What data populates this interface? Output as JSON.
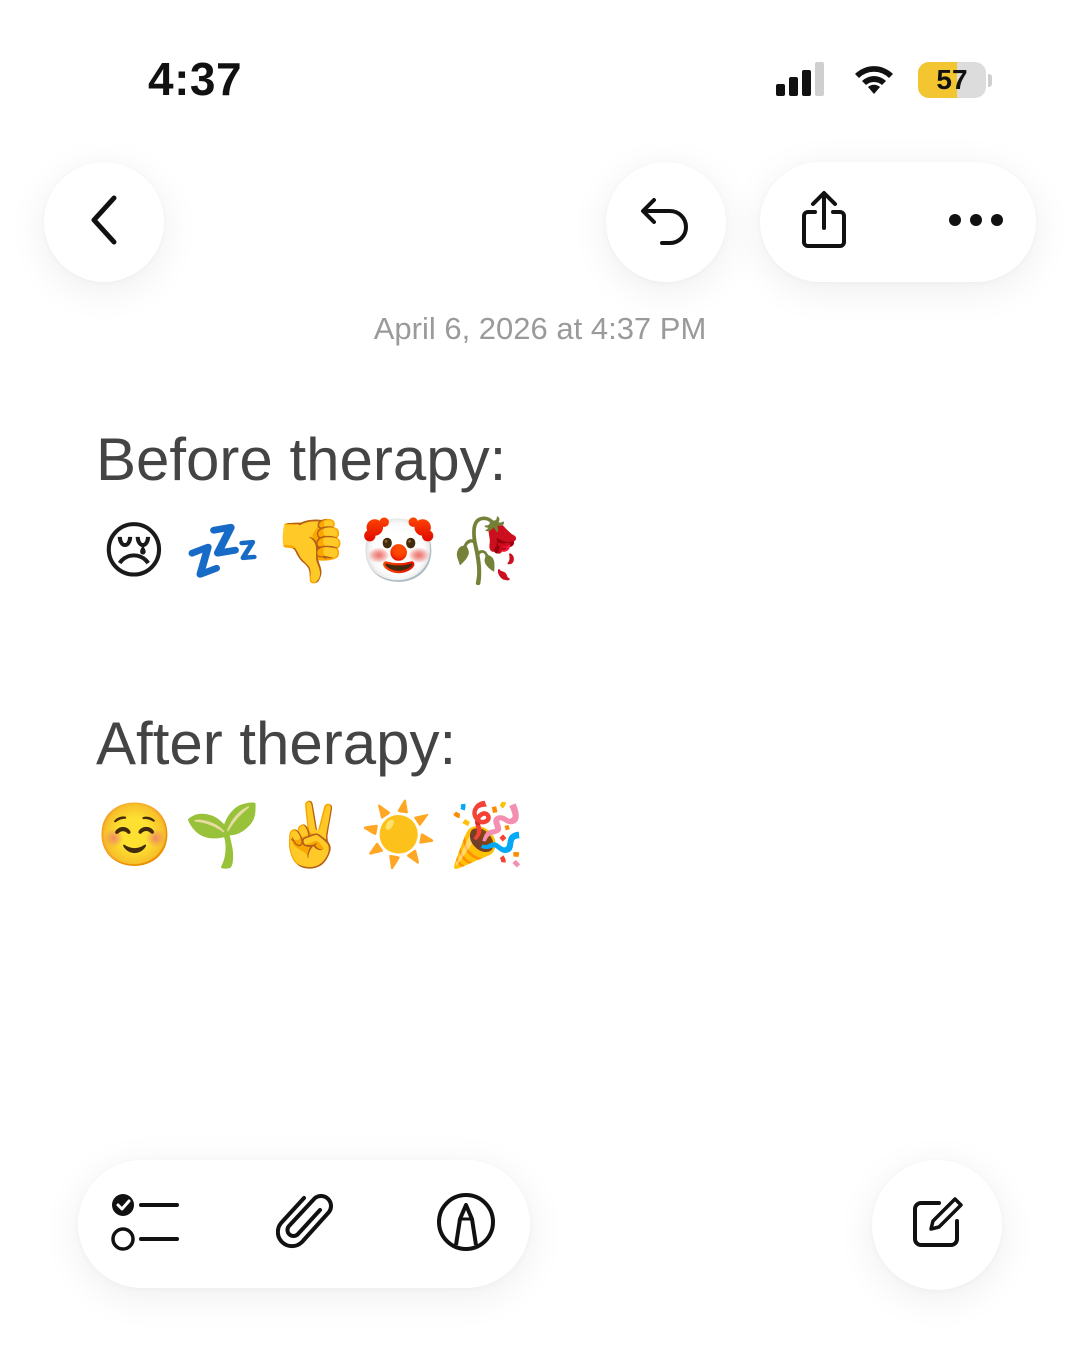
{
  "status_bar": {
    "time": "4:37",
    "battery_level": "57",
    "battery_fraction": 0.57,
    "icons": [
      "cellular-signal-icon",
      "wifi-icon",
      "battery-icon"
    ]
  },
  "toolbar": {
    "back_icon": "chevron-left-icon",
    "undo_icon": "undo-icon",
    "share_icon": "share-icon",
    "more_icon": "ellipsis-icon"
  },
  "note": {
    "date": "April 6, 2026 at 4:37 PM",
    "sections": [
      {
        "heading": "Before therapy:",
        "emojis": [
          "😢",
          "💤",
          "👎",
          "🤡",
          "🥀"
        ]
      },
      {
        "heading": "After therapy:",
        "emojis": [
          "☺️",
          "🌱",
          "✌️",
          "☀️",
          "🎉"
        ]
      }
    ]
  },
  "bottom_bar": {
    "icons": [
      "checklist-icon",
      "paperclip-icon",
      "markup-pen-icon",
      "compose-icon"
    ]
  },
  "colors": {
    "battery_fill": "#f2c531",
    "date_text": "#9a9a9a",
    "body_text": "#444444"
  }
}
